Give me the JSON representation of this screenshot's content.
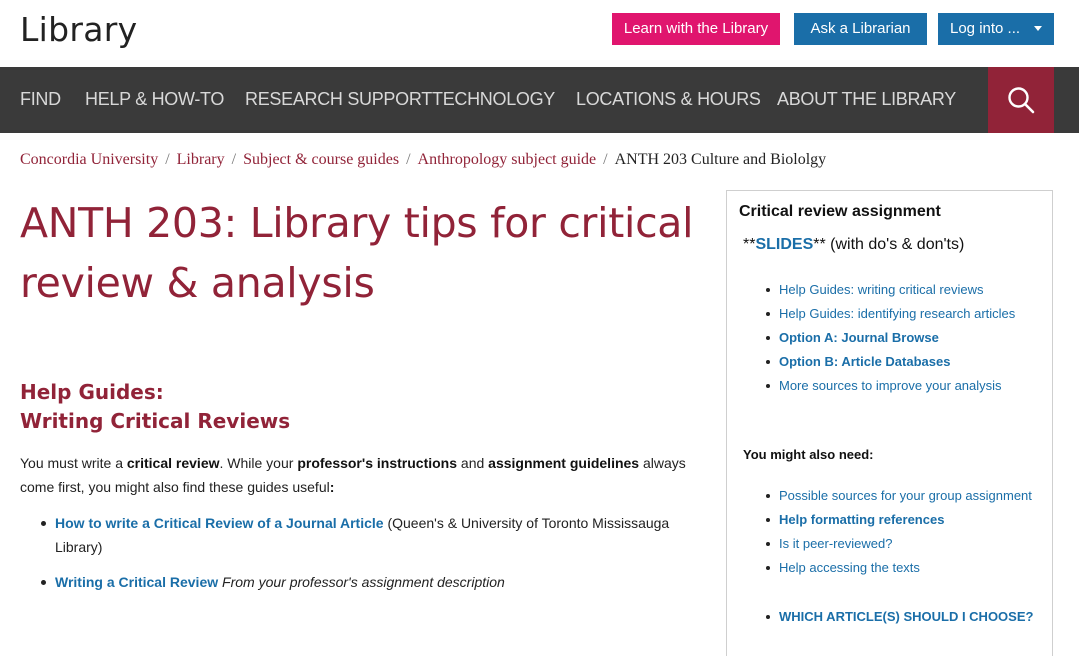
{
  "header": {
    "logo": "Library",
    "learn_button": "Learn with the Library",
    "ask_button": "Ask a Librarian",
    "login_button": "Log into ..."
  },
  "nav": {
    "items": [
      "FIND",
      "HELP & HOW-TO",
      "RESEARCH SUPPORT",
      "TECHNOLOGY",
      "LOCATIONS & HOURS",
      "ABOUT THE LIBRARY"
    ],
    "search_icon": "search-icon"
  },
  "breadcrumb": {
    "items": [
      "Concordia University",
      "Library",
      "Subject & course guides",
      "Anthropology subject guide"
    ],
    "current": "ANTH 203 Culture and Biololgy",
    "separator": "/"
  },
  "main": {
    "title": "ANTH 203: Library tips for critical review & analysis",
    "section_title_line1": "Help Guides:",
    "section_title_line2": "Writing Critical Reviews",
    "intro": {
      "t1": "You must write a ",
      "b1": "critical review",
      "t2": ". While your ",
      "b2": "professor's instructions",
      "t3": " and ",
      "b3": "assignment guidelines",
      "t4": " always come first, you might also find these guides useful",
      "b4": ":"
    },
    "links": [
      {
        "label": "How to write a Critical Review of a Journal Article",
        "note": " (Queen's & University of Toronto Mississauga Library)"
      },
      {
        "label": "Writing a Critical Review",
        "note": " From your professor's assignment description"
      }
    ]
  },
  "sidebar": {
    "title": "Critical review assignment",
    "slides_prefix": "**",
    "slides_link": "SLIDES",
    "slides_suffix": "** (with do's & don'ts)",
    "list1": [
      "Help Guides: writing critical reviews",
      "Help Guides: identifying research articles",
      "Option A: Journal Browse",
      "Option B: Article Databases",
      "More sources to improve your analysis"
    ],
    "also_need": "You might also need:",
    "list2": [
      "Possible sources for your group assignment",
      "Help formatting references",
      "Is it peer-reviewed?",
      "Help accessing the texts"
    ],
    "list3": [
      "WHICH ARTICLE(S) SHOULD I CHOOSE?"
    ]
  },
  "colors": {
    "brand_maroon": "#912338",
    "pink": "#e0156e",
    "link_blue": "#1a6ea8",
    "nav_bg": "#3a3a3a"
  }
}
